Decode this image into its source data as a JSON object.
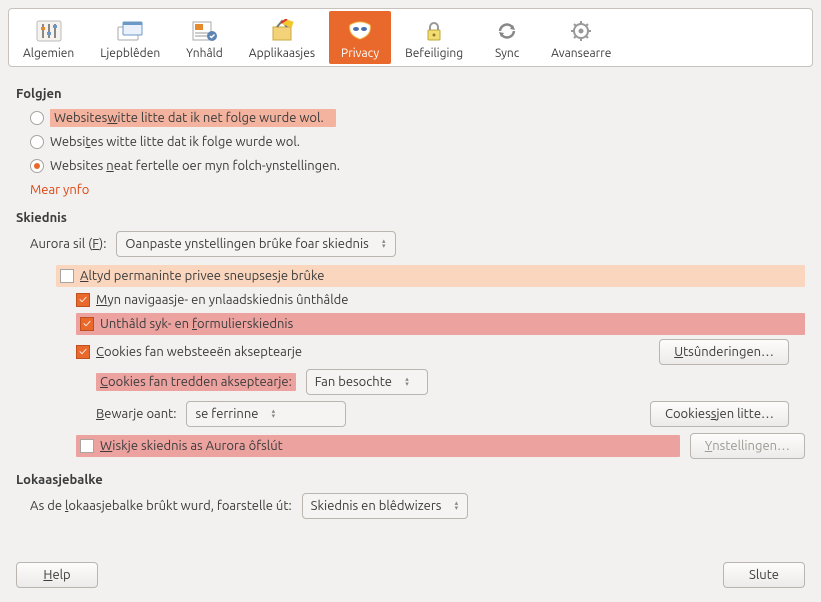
{
  "toolbar": {
    "items": [
      {
        "label": "Algemien"
      },
      {
        "label": "Ljepblêden"
      },
      {
        "label": "Ynhâld"
      },
      {
        "label": "Applikaasjes"
      },
      {
        "label": "Privacy"
      },
      {
        "label": "Befeiliging"
      },
      {
        "label": "Sync"
      },
      {
        "label": "Avansearre"
      }
    ]
  },
  "tracking": {
    "heading": "Folgjen",
    "opt1_a": "Websites ",
    "opt1_u": "w",
    "opt1_b": "itte litte dat ik net folge wurde wol.",
    "opt2_a": "Websi",
    "opt2_u": "t",
    "opt2_b": "es witte litte dat ik folge wurde wol.",
    "opt3_a": "Websites ",
    "opt3_u": "n",
    "opt3_b": "eat fertelle oer myn folch-ynstellingen.",
    "more": "Mear ynfo"
  },
  "history": {
    "heading": "Skiednis",
    "will_a": "Aurora sil (",
    "will_u": "F",
    "will_b": "):",
    "mode": "Oanpaste ynstellingen brûke foar skiednis",
    "perm_a": "A",
    "perm_b": "ltyd permaninte privee sneupsesje brûke",
    "nav_a": "M",
    "nav_b": "yn navigaasje- en ynlaadskiednis ûnthâlde",
    "form_a": "Unthâld syk- en ",
    "form_u": "f",
    "form_b": "ormulierskiednis",
    "cook_a": "C",
    "cook_b": "ookies fan websteeën akseptearje",
    "third_a": "C",
    "third_b": "ookies fan tredden akseptearje:",
    "third_val": "Fan besochte",
    "keep_a": "B",
    "keep_b": "ewarje oant:",
    "keep_val": "se ferrinne",
    "clear_a": "W",
    "clear_b": "iskje skiednis as Aurora ôfslút",
    "btn_exc_a": "U",
    "btn_exc_b": "tsûnderingen…",
    "btn_show_a": "Cookies ",
    "btn_show_u": "s",
    "btn_show_b": "jen litte…",
    "btn_set_a": "Y",
    "btn_set_b": "nstellingen…"
  },
  "locationbar": {
    "heading": "Lokaasjebalke",
    "label_a": "As de ",
    "label_u": "l",
    "label_b": "okaasjebalke brûkt wurd, foarstelle út:",
    "value": "Skiednis en blêdwizers"
  },
  "buttons": {
    "help_u": "H",
    "help_b": "elp",
    "close": "Slute"
  }
}
